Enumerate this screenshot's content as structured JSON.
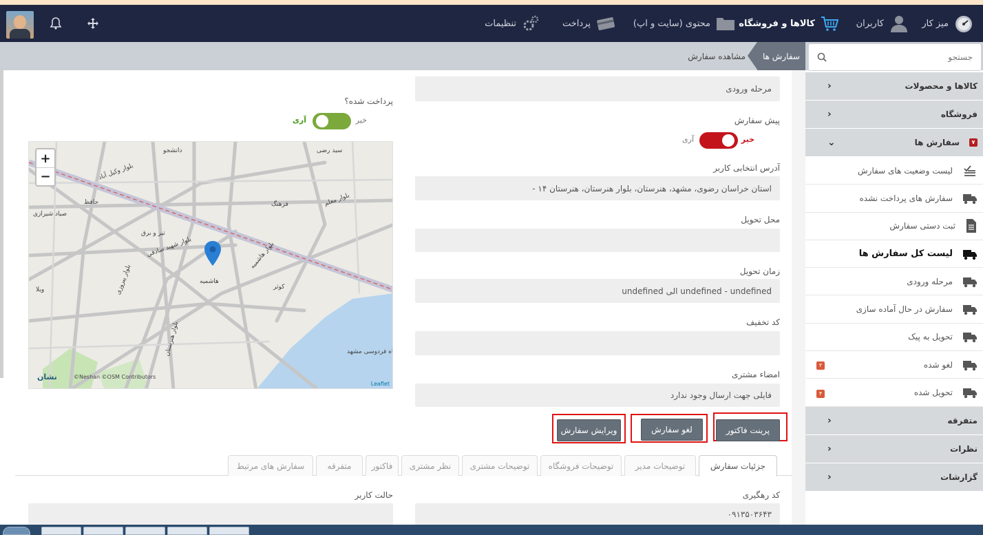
{
  "topbar": {
    "items": [
      {
        "label": "میز کار",
        "icon": "speedometer-icon"
      },
      {
        "label": "کاربران",
        "icon": "user-icon"
      },
      {
        "label": "کالاها و فروشگاه",
        "icon": "cart-icon"
      },
      {
        "label": "محتوی (سایت و اپ)",
        "icon": "folder-icon"
      },
      {
        "label": "پرداخت",
        "icon": "card-icon"
      },
      {
        "label": "تنظیمات",
        "icon": "gear-icon"
      }
    ]
  },
  "search": {
    "placeholder": "جستجو"
  },
  "breadcrumb": {
    "main": "سفارش ها",
    "current": "مشاهده سفارش"
  },
  "sidebar": {
    "products": "کالاها و محصولات",
    "store": "فروشگاه",
    "orders": {
      "label": "سفارش ها",
      "badge": "۷"
    },
    "order_items": [
      {
        "label": "لیست وضعیت های سفارش",
        "icon": "list-status-icon",
        "badge": ""
      },
      {
        "label": "سفارش های پرداخت نشده",
        "icon": "truck-icon",
        "badge": ""
      },
      {
        "label": "ثبت دستی سفارش",
        "icon": "document-icon",
        "badge": ""
      },
      {
        "label": "لیست کل سفارش ها",
        "icon": "truck-icon",
        "badge": ""
      },
      {
        "label": "مرحله ورودی",
        "icon": "truck-icon",
        "badge": ""
      },
      {
        "label": "سفارش در حال آماده سازی",
        "icon": "truck-icon",
        "badge": ""
      },
      {
        "label": "تحویل به پیک",
        "icon": "truck-icon",
        "badge": ""
      },
      {
        "label": "لغو شده",
        "icon": "truck-icon",
        "badge": "۳"
      },
      {
        "label": "تحویل شده",
        "icon": "truck-icon",
        "badge": "۴"
      }
    ],
    "misc": "متفرقه",
    "comments": "نظرات",
    "reports": "گزارشات"
  },
  "form": {
    "status_value": "مرحله ورودی",
    "preorder_label": "پیش سفارش",
    "preorder_no": "خیر",
    "preorder_yes": "آری",
    "address_label": "آدرس انتخابی کاربر",
    "address_value": "استان خراسان رضوی، مشهد، هنرستان، بلوار هنرستان، هنرستان ۱۴ -",
    "delivery_place_label": "محل تحویل",
    "delivery_place_value": "",
    "delivery_time_label": "زمان تحویل",
    "delivery_time_value": "undefined - undefined الی undefined",
    "discount_label": "کد تخفیف",
    "discount_value": "",
    "signature_label": "امضاء مشتری",
    "signature_value": "فایلی جهت ارسال وجود ندارد",
    "paid_label": "پرداخت شده؟",
    "paid_no": "خیر",
    "paid_yes": "آری",
    "tracking_label": "کد رهگیری",
    "tracking_value": "۰۹۱۳۵۰۳۶۴۳",
    "user_state_label": "حالت کاربر",
    "user_state_value": ""
  },
  "buttons": {
    "print": "پرینت فاکتور",
    "cancel": "لغو سفارش",
    "edit": "ویرایش سفارش"
  },
  "tabs": [
    "جزئیات سفارش",
    "توضیحات مدیر",
    "توضیحات فروشگاه",
    "توضیحات مشتری",
    "نظر مشتری",
    "فاکتور",
    "متفرقه",
    "سفارش های مرتبط"
  ],
  "map": {
    "streets": [
      "بلوار وکیل آباد",
      "دانشجو",
      "سید رضی",
      "حافظ",
      "فرهنگ",
      "هاشمیه",
      "کوثر",
      "ویلا",
      "صیاد شیرازی",
      "بلوار معلم",
      "بلوار هاشمیه",
      "بلوار هنرستان",
      "بلوار پیروزی",
      "تیر و برق",
      "بلوار شهید صادقی",
      "دانشگاه فردوسی مشهد"
    ],
    "attribution": "©Neshan ©OSM Contributors",
    "leaflet": "Leaflet",
    "logo": "نشان"
  },
  "colors": {
    "topbar": "#1e2642",
    "accent_red": "#c4141b",
    "accent_green": "#7ca93c",
    "button": "#66707a"
  }
}
